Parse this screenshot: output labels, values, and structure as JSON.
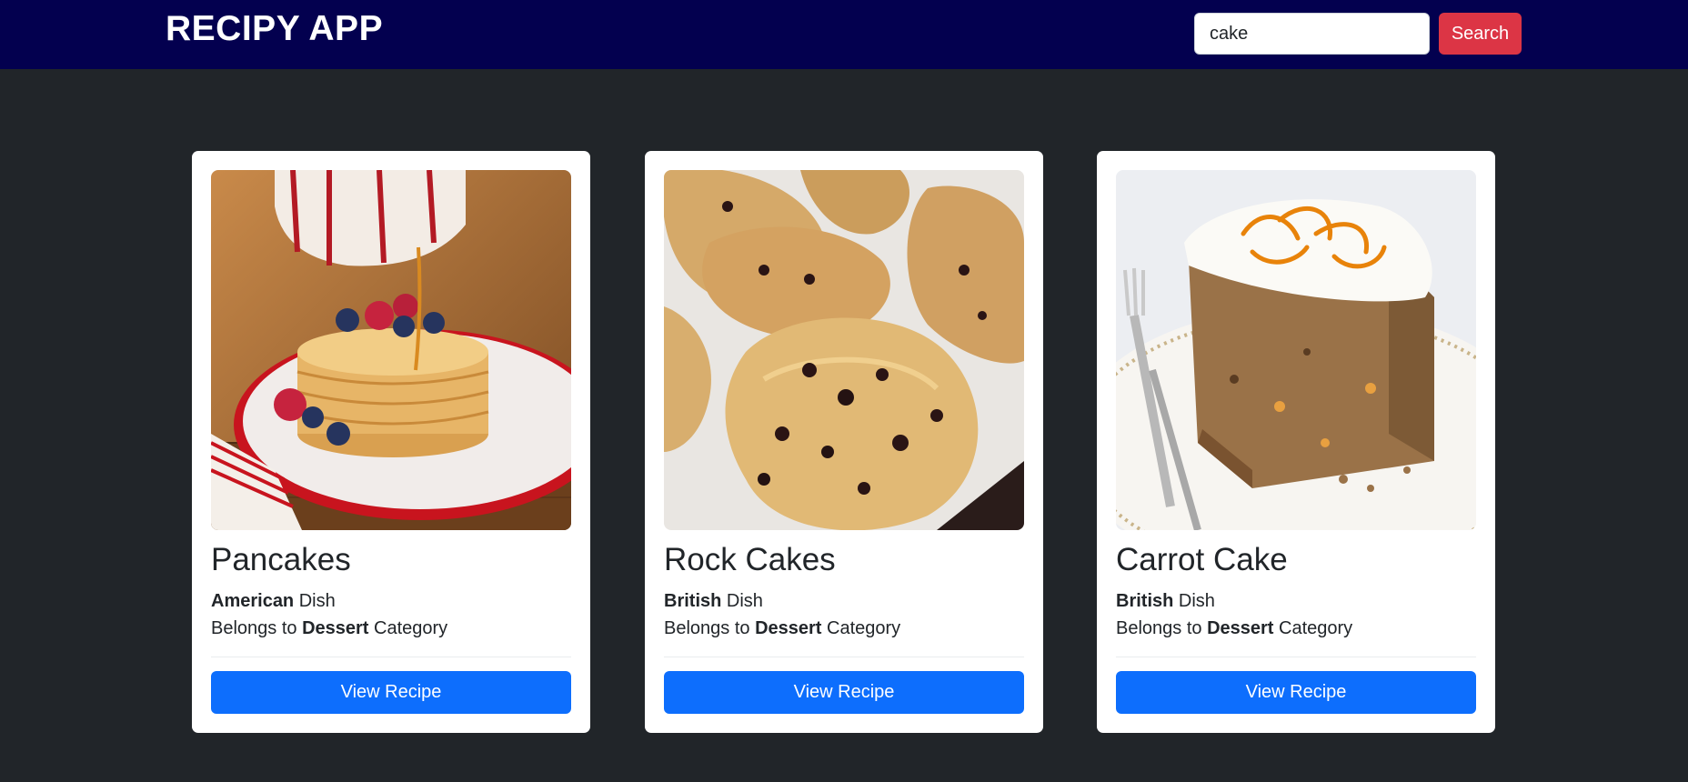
{
  "navbar": {
    "brand": "RECIPY APP",
    "search": {
      "value": "cake",
      "button_label": "Search"
    }
  },
  "cards": [
    {
      "title": "Pancakes",
      "area": "American",
      "area_suffix": " Dish",
      "category_prefix": "Belongs to ",
      "category": "Dessert",
      "category_suffix": " Category",
      "button_label": "View Recipe",
      "image": "pancakes-photo"
    },
    {
      "title": "Rock Cakes",
      "area": "British",
      "area_suffix": " Dish",
      "category_prefix": "Belongs to ",
      "category": "Dessert",
      "category_suffix": " Category",
      "button_label": "View Recipe",
      "image": "rock-cakes-photo"
    },
    {
      "title": "Carrot Cake",
      "area": "British",
      "area_suffix": " Dish",
      "category_prefix": "Belongs to ",
      "category": "Dessert",
      "category_suffix": " Category",
      "button_label": "View Recipe",
      "image": "carrot-cake-photo"
    }
  ],
  "colors": {
    "navbar": "#03004f",
    "page_bg": "#212529",
    "search_button": "#dc3545",
    "view_button": "#0d6efd"
  }
}
